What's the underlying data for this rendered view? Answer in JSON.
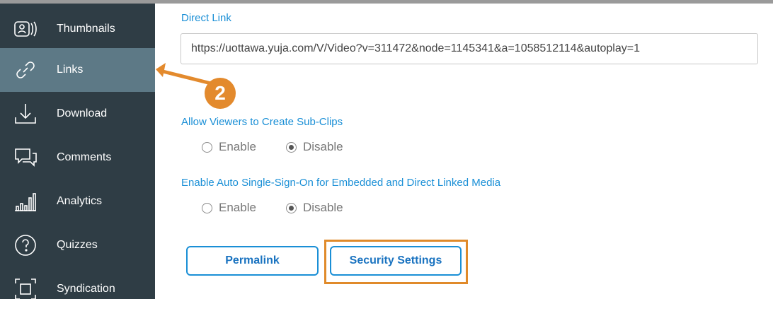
{
  "sidebar": {
    "items": [
      {
        "label": "Thumbnails",
        "icon": "thumbnails-icon"
      },
      {
        "label": "Links",
        "icon": "link-icon",
        "active": true
      },
      {
        "label": "Download",
        "icon": "download-icon"
      },
      {
        "label": "Comments",
        "icon": "comments-icon"
      },
      {
        "label": "Analytics",
        "icon": "analytics-icon"
      },
      {
        "label": "Quizzes",
        "icon": "quiz-icon"
      },
      {
        "label": "Syndication",
        "icon": "syndication-icon"
      }
    ]
  },
  "main": {
    "direct_link_label": "Direct Link",
    "direct_link_value": "https://uottawa.yuja.com/V/Video?v=311472&node=1145341&a=1058512114&autoplay=1",
    "subclips": {
      "label": "Allow Viewers to Create Sub-Clips",
      "options": [
        "Enable",
        "Disable"
      ],
      "selected": "Disable"
    },
    "sso": {
      "label": "Enable Auto Single-Sign-On for Embedded and Direct Linked Media",
      "options": [
        "Enable",
        "Disable"
      ],
      "selected": "Disable"
    },
    "buttons": {
      "permalink": "Permalink",
      "security": "Security Settings"
    }
  },
  "annotation": {
    "step_number": "2"
  },
  "colors": {
    "sidebar_bg": "#2f3d45",
    "sidebar_active": "#5d7986",
    "accent_blue": "#1a8fd6",
    "callout_orange": "#e38a2d"
  }
}
